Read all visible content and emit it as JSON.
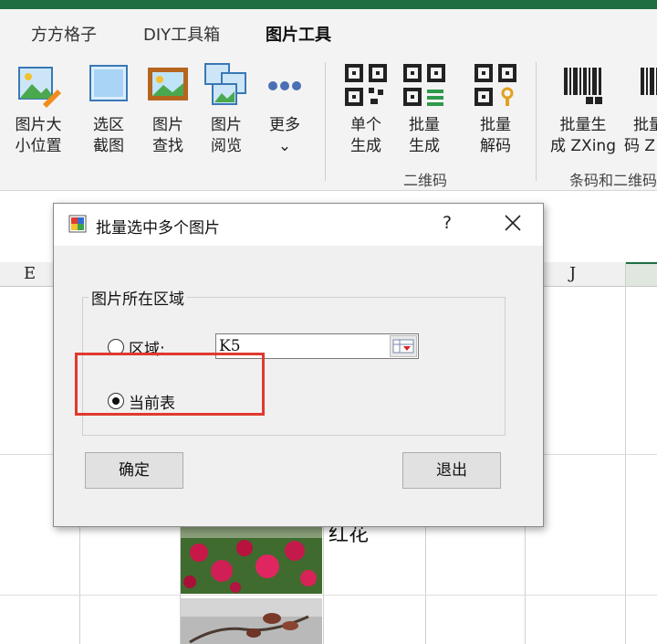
{
  "ribbon": {
    "tabs": [
      "方方格子",
      "DIY工具箱",
      "图片工具"
    ],
    "active_tab": "图片工具",
    "buttons": [
      {
        "label1": "图片大",
        "label2": "小位置",
        "icon": "picture-resize-icon"
      },
      {
        "label1": "选区",
        "label2": "截图",
        "icon": "screenshot-icon"
      },
      {
        "label1": "图片",
        "label2": "查找",
        "icon": "picture-find-icon"
      },
      {
        "label1": "图片",
        "label2": "阅览",
        "icon": "picture-browse-icon"
      },
      {
        "label1": "更多",
        "label2": "⌄",
        "icon": "more-dots-icon"
      },
      {
        "label1": "单个",
        "label2": "生成",
        "icon": "qrcode-icon"
      },
      {
        "label1": "批量",
        "label2": "生成",
        "icon": "qrcode-batch-icon"
      },
      {
        "label1": "批量",
        "label2": "解码",
        "icon": "qrcode-decode-icon"
      },
      {
        "label1": "批量生",
        "label2": "成 ZXing",
        "icon": "barcode-icon"
      },
      {
        "label1": "批量",
        "label2": "码 Z",
        "icon": "barcode-icon"
      }
    ],
    "groups": [
      "二维码",
      "条码和二维码"
    ]
  },
  "sheet": {
    "columns": [
      "E",
      "J"
    ],
    "cell_text": "红花"
  },
  "dialog": {
    "title": "批量选中多个图片",
    "help": "?",
    "group_label": "图片所在区域",
    "option_range_label": "区域:",
    "range_value": "K5",
    "option_current_label": "当前表",
    "selected_option": "当前表",
    "ok_label": "确定",
    "exit_label": "退出",
    "highlight_color": "#e0392e"
  }
}
